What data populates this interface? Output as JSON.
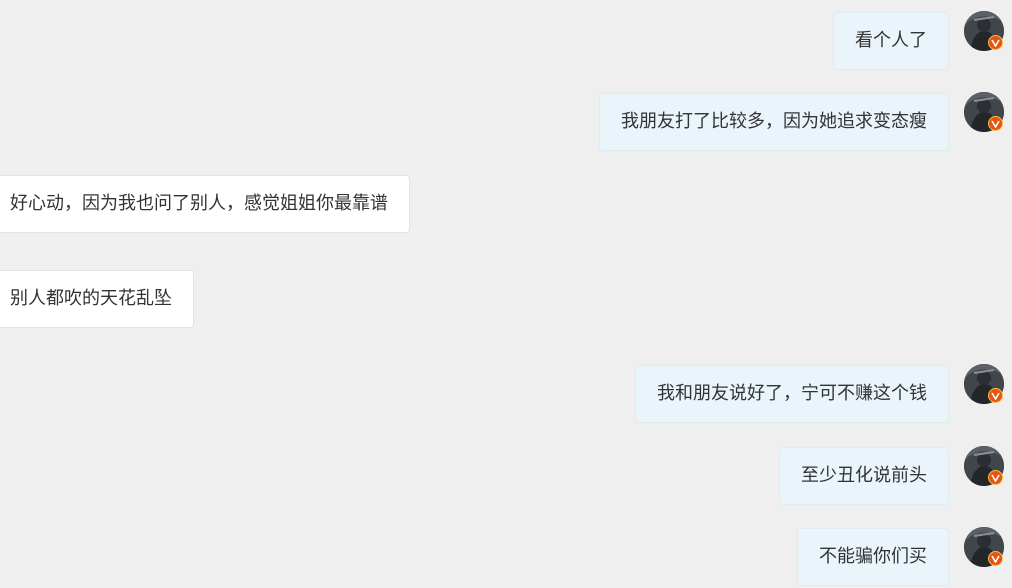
{
  "chat": {
    "messages": [
      {
        "side": "me",
        "text": "看个人了"
      },
      {
        "side": "me",
        "text": "我朋友打了比较多，因为她追求变态瘦"
      },
      {
        "side": "other",
        "text": "好心动，因为我也问了别人，感觉姐姐你最靠谱"
      },
      {
        "side": "other",
        "text": "别人都吹的天花乱坠"
      },
      {
        "side": "me",
        "text": "我和朋友说好了，宁可不赚这个钱"
      },
      {
        "side": "me",
        "text": "至少丑化说前头"
      },
      {
        "side": "me",
        "text": "不能骗你们买"
      }
    ],
    "avatar_icon": "user-avatar-icon",
    "verified_badge_icon": "verified-v-icon",
    "colors": {
      "background": "#efefef",
      "my_bubble": "#e9f4fb",
      "other_bubble": "#ffffff",
      "badge": "#e8530e"
    }
  }
}
